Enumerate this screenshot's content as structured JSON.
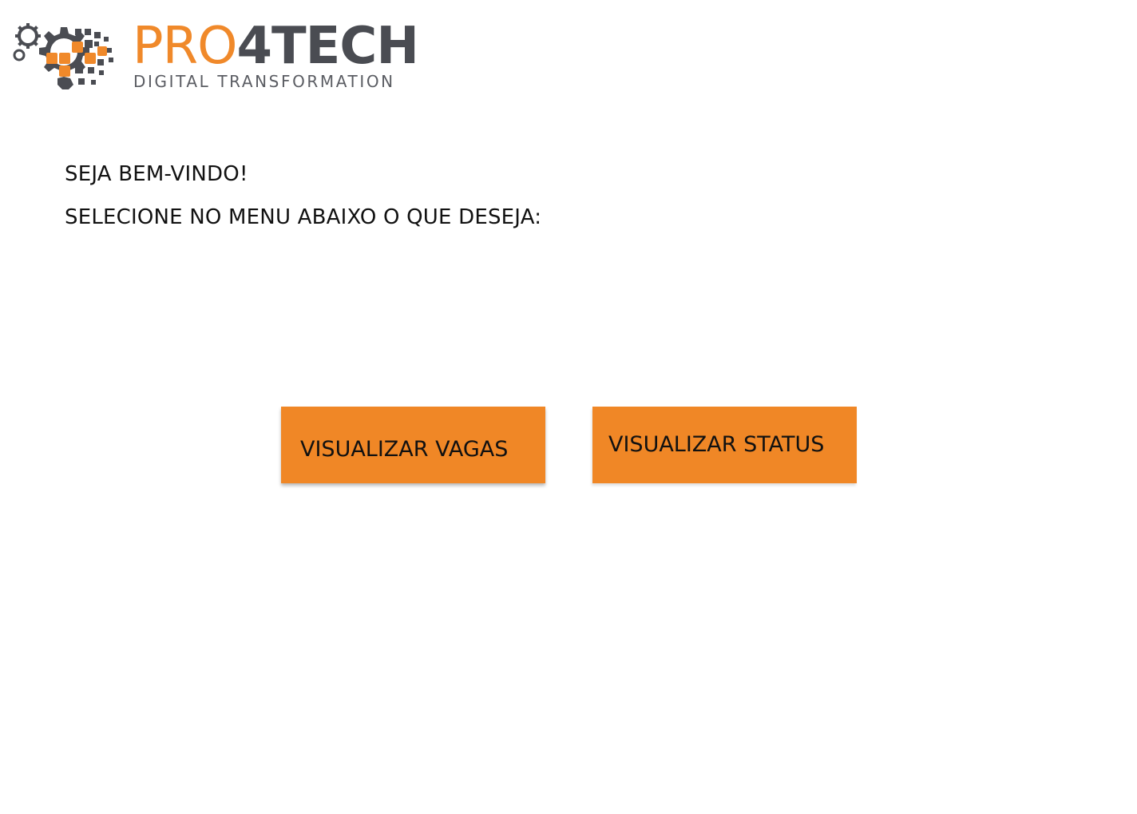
{
  "brand": {
    "name_part1": "PRO",
    "name_part2": "4TECH",
    "tagline": "DIGITAL TRANSFORMATION",
    "colors": {
      "orange": "#f0892a",
      "gray": "#4a4c52"
    },
    "icon": "gear-pixels-logo-icon"
  },
  "main": {
    "welcome": "SEJA BEM-VINDO!",
    "instruction": "SELECIONE NO MENU ABAIXO O QUE DESEJA:"
  },
  "menu": {
    "button_color": "#f08726",
    "view_jobs_label": "VISUALIZAR VAGAS",
    "view_status_label": "VISUALIZAR STATUS"
  }
}
